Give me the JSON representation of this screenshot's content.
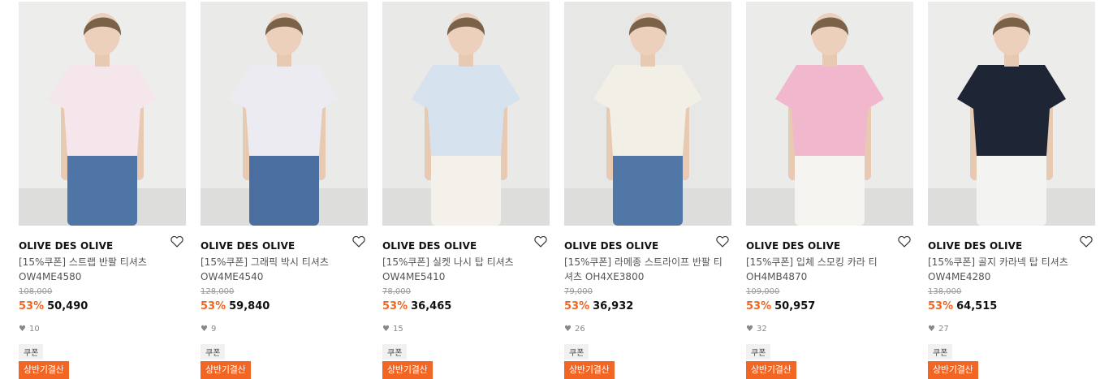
{
  "products": [
    {
      "badge": "상반기결산",
      "brand": "OLIVE DES OLIVE",
      "name": "[15%쿠폰] 스트랩 반팔 티셔츠 OW4ME4580",
      "original_price": "108,000",
      "discount": "53%",
      "price": "50,490",
      "likes": "10",
      "coupon": "쿠폰",
      "colors": {
        "top": "#f4e6ea",
        "bottom": "#4f75a6",
        "bg": "#ededeb"
      }
    },
    {
      "badge": "상반기결산",
      "brand": "OLIVE DES OLIVE",
      "name": "[15%쿠폰] 그래픽 박시 티셔츠 OW4ME4540",
      "original_price": "128,000",
      "discount": "53%",
      "price": "59,840",
      "likes": "9",
      "coupon": "쿠폰",
      "colors": {
        "top": "#ecebf1",
        "bottom": "#4a6e9f",
        "bg": "#eaeae8"
      }
    },
    {
      "badge": "상반기결산",
      "brand": "OLIVE DES OLIVE",
      "name": "[15%쿠폰] 실켓 나시 탑 티셔츠 OW4ME5410",
      "original_price": "78,000",
      "discount": "53%",
      "price": "36,465",
      "likes": "15",
      "coupon": "쿠폰",
      "colors": {
        "top": "#d6e2ee",
        "bottom": "#f4f1ea",
        "bg": "#e9e9e7"
      }
    },
    {
      "badge": "상반기결산",
      "brand": "OLIVE DES OLIVE",
      "name": "[15%쿠폰] 라메종 스트라이프 반팔 티셔츠 OH4XE3800",
      "original_price": "79,000",
      "discount": "53%",
      "price": "36,932",
      "likes": "26",
      "coupon": "쿠폰",
      "colors": {
        "top": "#f2efe6",
        "bottom": "#5077a6",
        "bg": "#e7e7e6"
      }
    },
    {
      "badge": "상반기결산",
      "brand": "OLIVE DES OLIVE",
      "name": "[15%쿠폰] 입체 스모킹 카라 티 OH4MB4870",
      "original_price": "109,000",
      "discount": "53%",
      "price": "50,957",
      "likes": "32",
      "coupon": "쿠폰",
      "colors": {
        "top": "#f1b7cd",
        "bottom": "#f5f4f0",
        "bg": "#ebebea"
      }
    },
    {
      "badge": "상반기결산",
      "brand": "OLIVE DES OLIVE",
      "name": "[15%쿠폰] 골지 카라넥 탑 티셔츠 OW4ME4280",
      "original_price": "138,000",
      "discount": "53%",
      "price": "64,515",
      "likes": "27",
      "coupon": "쿠폰",
      "colors": {
        "top": "#1e2535",
        "bottom": "#f3f3f1",
        "bg": "#ececea"
      }
    }
  ]
}
